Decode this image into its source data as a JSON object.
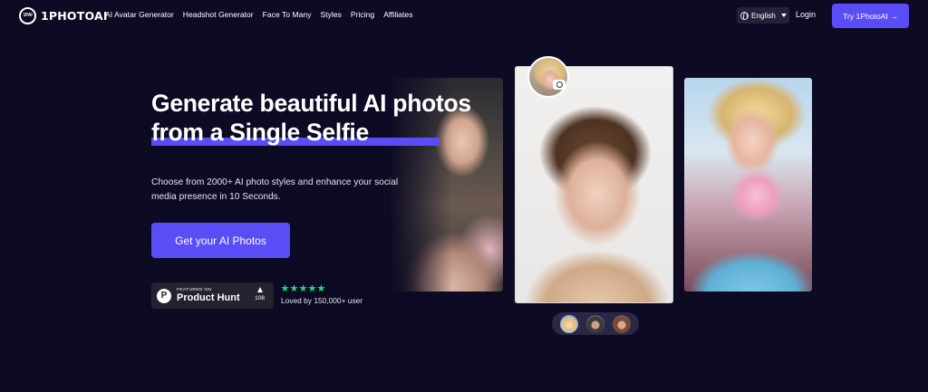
{
  "brand": {
    "name": "1PHOTOAI",
    "mark": "1PAI"
  },
  "nav": {
    "items": [
      "AI Avatar Generator",
      "Headshot Generator",
      "Face To Many",
      "Styles",
      "Pricing",
      "Affiliates"
    ],
    "language": "English",
    "login": "Login",
    "cta": "Try 1PhotoAI →"
  },
  "hero": {
    "headline_line1": "Generate beautiful AI photos",
    "headline_line2": "from a Single Selfie",
    "subtext": "Choose from 2000+ AI photo styles and enhance your social media presence in 10 Seconds.",
    "cta": "Get your AI Photos"
  },
  "product_hunt": {
    "featured": "FEATURED ON",
    "name": "Product Hunt",
    "icon_letter": "P",
    "votes": "108"
  },
  "rating": {
    "stars": 5,
    "loved_text": "Loved by 150,000+ user"
  },
  "colors": {
    "accent": "#5b4df5",
    "background": "#0d0b24",
    "star": "#2bd47d"
  },
  "icons": [
    "globe-icon",
    "caret-down-icon",
    "camera-icon",
    "upvote-arrow-icon",
    "star-icon"
  ]
}
